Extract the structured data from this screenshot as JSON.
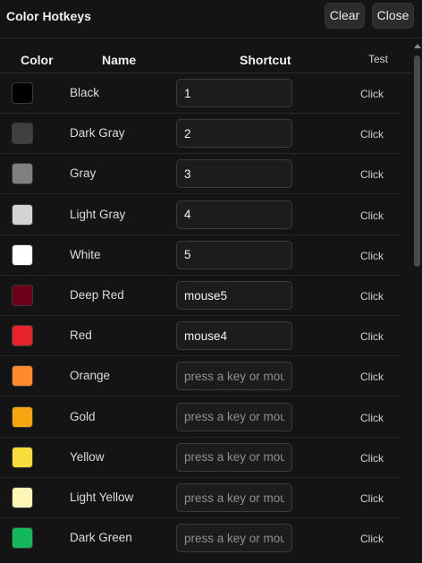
{
  "header": {
    "title": "Color Hotkeys",
    "clear_label": "Clear",
    "close_label": "Close"
  },
  "table": {
    "columns": {
      "color": "Color",
      "name": "Name",
      "shortcut": "Shortcut",
      "test": "Test"
    },
    "placeholder": "press a key or mouse",
    "rows": [
      {
        "name": "Black",
        "color": "#000000",
        "shortcut": "1",
        "test": "Click"
      },
      {
        "name": "Dark Gray",
        "color": "#404040",
        "shortcut": "2",
        "test": "Click"
      },
      {
        "name": "Gray",
        "color": "#808080",
        "shortcut": "3",
        "test": "Click"
      },
      {
        "name": "Light Gray",
        "color": "#d3d3d3",
        "shortcut": "4",
        "test": "Click"
      },
      {
        "name": "White",
        "color": "#ffffff",
        "shortcut": "5",
        "test": "Click"
      },
      {
        "name": "Deep Red",
        "color": "#6b0018",
        "shortcut": "mouse5",
        "test": "Click"
      },
      {
        "name": "Red",
        "color": "#e8212b",
        "shortcut": "mouse4",
        "test": "Click"
      },
      {
        "name": "Orange",
        "color": "#ff8a2e",
        "shortcut": "",
        "test": "Click"
      },
      {
        "name": "Gold",
        "color": "#f6a50e",
        "shortcut": "",
        "test": "Click"
      },
      {
        "name": "Yellow",
        "color": "#f9de3b",
        "shortcut": "",
        "test": "Click"
      },
      {
        "name": "Light Yellow",
        "color": "#fff5b5",
        "shortcut": "",
        "test": "Click"
      },
      {
        "name": "Dark Green",
        "color": "#12b85a",
        "shortcut": "",
        "test": "Click"
      }
    ]
  }
}
